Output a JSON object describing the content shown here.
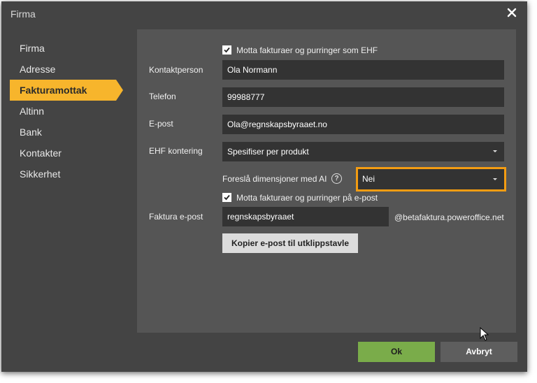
{
  "dialog": {
    "title": "Firma"
  },
  "sidebar": {
    "items": [
      {
        "label": "Firma"
      },
      {
        "label": "Adresse"
      },
      {
        "label": "Fakturamottak"
      },
      {
        "label": "Altinn"
      },
      {
        "label": "Bank"
      },
      {
        "label": "Kontakter"
      },
      {
        "label": "Sikkerhet"
      }
    ],
    "active": "Fakturamottak"
  },
  "form": {
    "ehf_checkbox": {
      "label": "Motta fakturaer og purringer som EHF",
      "checked": true
    },
    "contact_person": {
      "label": "Kontaktperson",
      "value": "Ola Normann"
    },
    "phone": {
      "label": "Telefon",
      "value": "99988777"
    },
    "email": {
      "label": "E-post",
      "value": "Ola@regnskapsbyraaet.no"
    },
    "ehf_posting": {
      "label": "EHF kontering",
      "value": "Spesifiser per produkt"
    },
    "ai_dimensions": {
      "label": "Foreslå dimensjoner med AI",
      "help_glyph": "?",
      "value": "Nei"
    },
    "email_checkbox": {
      "label": "Motta fakturaer og purringer på e-post",
      "checked": true
    },
    "invoice_email": {
      "label": "Faktura e-post",
      "value": "regnskapsbyraaet",
      "suffix": "@betafaktura.poweroffice.net"
    },
    "copy_button": {
      "label": "Kopier e-post til utklippstavle"
    }
  },
  "footer": {
    "ok_label": "Ok",
    "cancel_label": "Avbryt"
  },
  "colors": {
    "accent": "#f7b52c",
    "ok_button": "#7aac4a",
    "cancel_button": "#5e5e5e",
    "highlight_border": "#f39c12"
  }
}
